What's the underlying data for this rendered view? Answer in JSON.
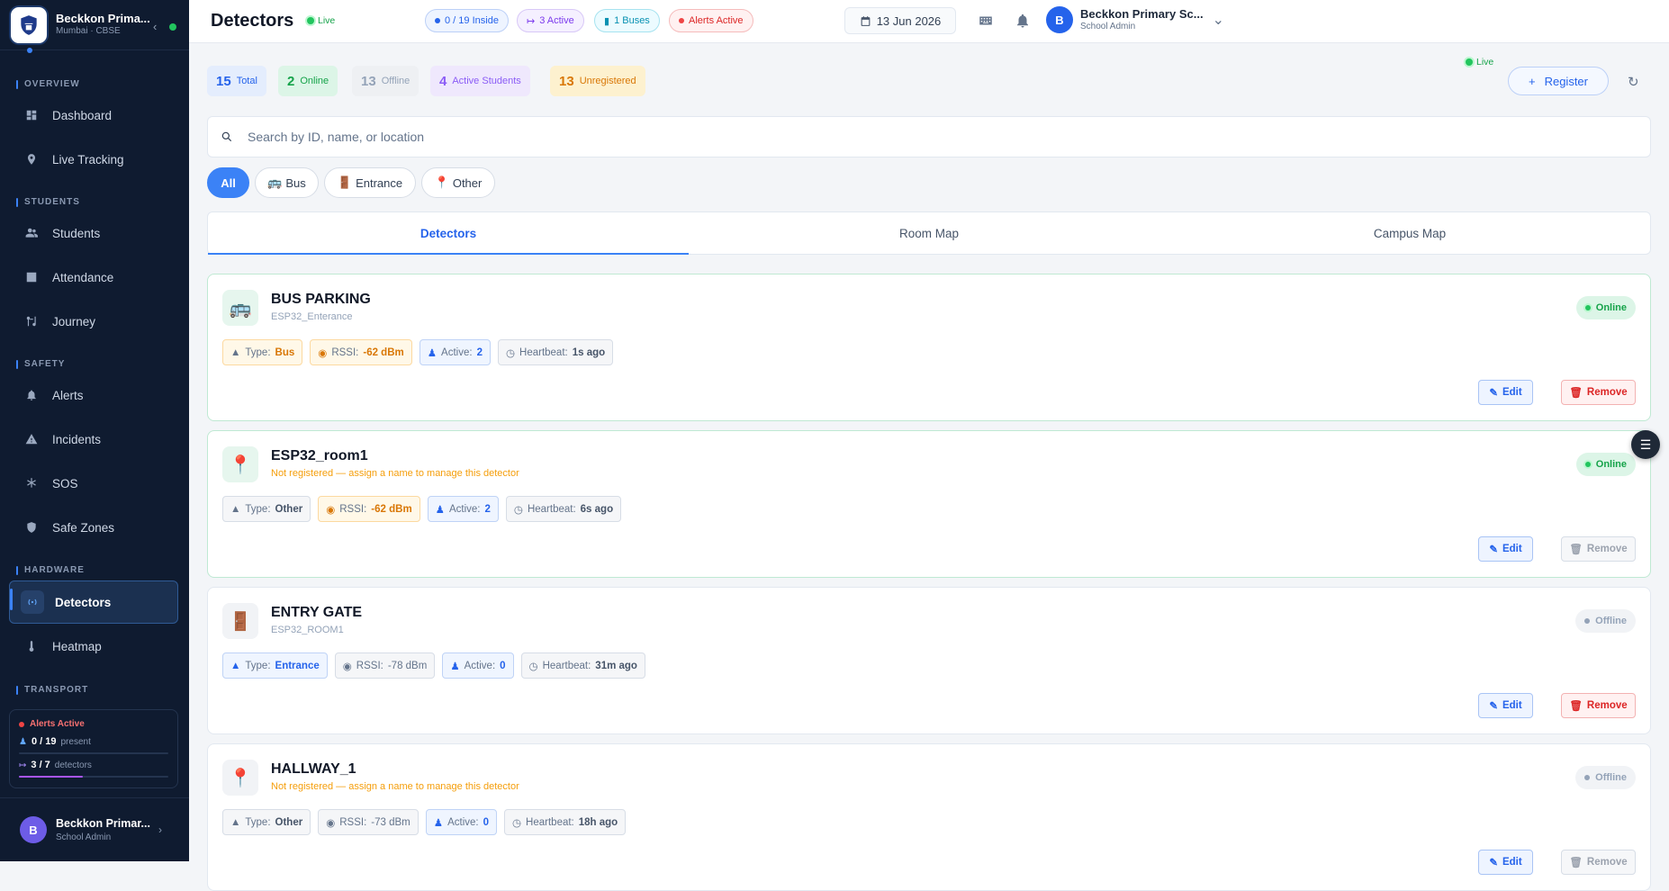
{
  "sidebar": {
    "school_name": "Beckkon Prima...",
    "school_sub": "Mumbai · CBSE",
    "sections": {
      "overview": "OVERVIEW",
      "students": "STUDENTS",
      "safety": "SAFETY",
      "hardware": "HARDWARE",
      "transport": "TRANSPORT"
    },
    "items": {
      "dashboard": "Dashboard",
      "live_tracking": "Live Tracking",
      "students": "Students",
      "attendance": "Attendance",
      "journey": "Journey",
      "alerts": "Alerts",
      "incidents": "Incidents",
      "sos": "SOS",
      "safe_zones": "Safe Zones",
      "detectors": "Detectors",
      "heatmap": "Heatmap"
    },
    "card": {
      "alert": "Alerts Active",
      "present_count": "0 / 19",
      "present_label": "present",
      "present_fraction": 0.0,
      "detectors_count": "3 / 7",
      "detectors_label": "detectors",
      "detectors_fraction": 0.43
    },
    "user": {
      "initial": "B",
      "name": "Beckkon Primar...",
      "role": "School Admin"
    }
  },
  "topbar": {
    "title": "Detectors",
    "live": "Live",
    "pills": {
      "inside": "0 / 19 Inside",
      "active": "3 Active",
      "buses": "1 Buses",
      "alerts": "Alerts Active"
    },
    "date": "13 Jun 2026",
    "user": {
      "initial": "B",
      "name": "Beckkon Primary Sc...",
      "role": "School Admin"
    }
  },
  "stats": {
    "total": {
      "value": "15",
      "label": "Total"
    },
    "online": {
      "value": "2",
      "label": "Online"
    },
    "offline": {
      "value": "13",
      "label": "Offline"
    },
    "active_students": {
      "value": "4",
      "label": "Active Students"
    },
    "unregistered": {
      "value": "13",
      "label": "Unregistered"
    }
  },
  "live": "Live",
  "register": "Register",
  "search": {
    "placeholder": "Search by ID, name, or location"
  },
  "filters": {
    "all": "All",
    "bus": "Bus",
    "entrance": "Entrance",
    "other": "Other"
  },
  "tabs": {
    "detectors": "Detectors",
    "room_map": "Room Map",
    "campus_map": "Campus Map"
  },
  "labels": {
    "type": "Type:",
    "rssi": "RSSI:",
    "active": "Active:",
    "heartbeat": "Heartbeat:",
    "edit": "Edit",
    "remove": "Remove"
  },
  "detectors": [
    {
      "name": "BUS PARKING",
      "sub": "ESP32_Enterance",
      "status": "Online",
      "type": "Bus",
      "rssi": "-62 dBm",
      "active": "2",
      "heartbeat": "1s ago"
    },
    {
      "name": "ESP32_room1",
      "sub": "Not registered — assign a name to manage this detector",
      "status": "Online",
      "type": "Other",
      "rssi": "-62 dBm",
      "active": "2",
      "heartbeat": "6s ago"
    },
    {
      "name": "ENTRY GATE",
      "sub": "ESP32_ROOM1",
      "status": "Offline",
      "type": "Entrance",
      "rssi": "-78 dBm",
      "active": "0",
      "heartbeat": "31m ago"
    },
    {
      "name": "HALLWAY_1",
      "sub": "Not registered — assign a name to manage this detector",
      "status": "Offline",
      "type": "Other",
      "rssi": "-73 dBm",
      "active": "0",
      "heartbeat": "18h ago"
    }
  ]
}
